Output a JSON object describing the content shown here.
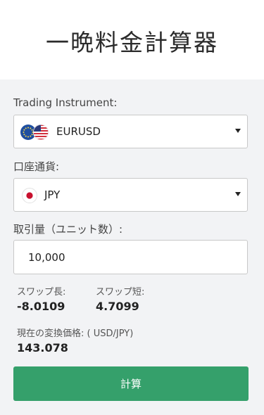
{
  "header": {
    "title": "一晩料金計算器"
  },
  "instrument": {
    "label": "Trading Instrument:",
    "value": "EURUSD",
    "flags": [
      "eu-flag-icon",
      "us-flag-icon"
    ]
  },
  "account_currency": {
    "label": "口座通貨:",
    "value": "JPY",
    "flag": "jp-flag-icon"
  },
  "volume": {
    "label": "取引量（ユニット数）:",
    "value": "10,000"
  },
  "swap_long": {
    "label": "スワップ長:",
    "value": "-8.0109"
  },
  "swap_short": {
    "label": "スワップ短:",
    "value": "4.7099"
  },
  "conversion": {
    "label": "現在の変換価格: ( USD/JPY)",
    "value": "143.078"
  },
  "calculate_button": {
    "label": "計算"
  },
  "colors": {
    "button": "#35a06b",
    "header_bg": "#ffffff",
    "panel_bg": "#f2f3f5"
  }
}
